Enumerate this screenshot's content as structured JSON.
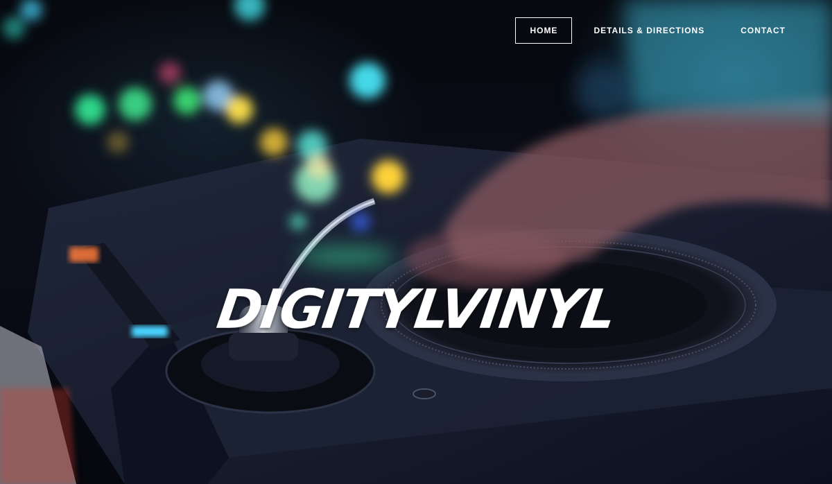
{
  "site": {
    "brand": "DIGITYLVINYL"
  },
  "nav": {
    "items": [
      {
        "label": "HOME",
        "active": true
      },
      {
        "label": "DETAILS & DIRECTIONS",
        "active": false
      },
      {
        "label": "CONTACT",
        "active": false
      }
    ]
  },
  "colors": {
    "nav_text": "#ffffff",
    "active_border": "#ffffff",
    "background": "#05060c"
  }
}
